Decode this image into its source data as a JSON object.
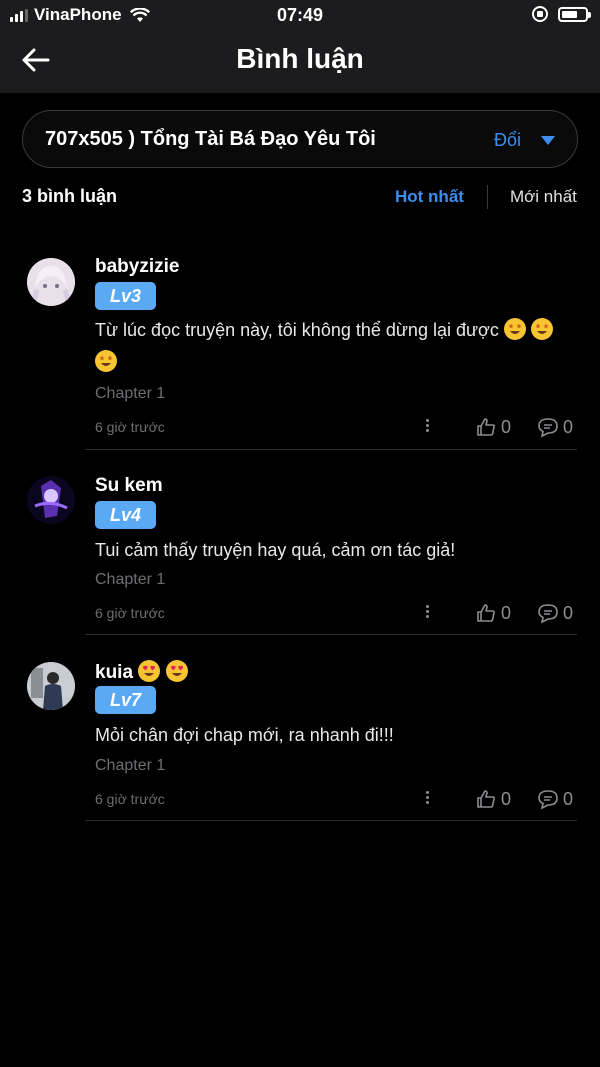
{
  "status": {
    "carrier": "VinaPhone",
    "time": "07:49"
  },
  "header": {
    "title": "Bình luận"
  },
  "selector": {
    "name": "707x505 ) Tổng Tài Bá Đạo Yêu Tôi",
    "change": "Đổi"
  },
  "summary": {
    "count": "3 bình luận",
    "sort_hot": "Hot nhất",
    "sort_new": "Mới nhất"
  },
  "comments": [
    {
      "user": "babyzizie",
      "level": "Lv3",
      "text": "Từ lúc đọc truyện này, tôi không thể dừng lại được",
      "chapter": "Chapter 1",
      "time": "6 giờ trước",
      "likes": "0",
      "replies": "0",
      "emoji": "star-struck"
    },
    {
      "user": "Su kem",
      "level": "Lv4",
      "text": "Tui cảm thấy truyện hay quá, cảm ơn tác giả!",
      "chapter": "Chapter 1",
      "time": "6 giờ trước",
      "likes": "0",
      "replies": "0"
    },
    {
      "user": "kuia",
      "level": "Lv7",
      "text": "Mỏi chân đợi chap mới, ra nhanh đi!!!",
      "chapter": "Chapter 1",
      "time": "6 giờ trước",
      "likes": "0",
      "replies": "0",
      "emoji": "heart-eyes"
    }
  ],
  "colors": {
    "accent": "#3d8ef0",
    "level_badge": "#5aa9f5",
    "background": "#000000",
    "header_bg": "#1c1c1e"
  }
}
